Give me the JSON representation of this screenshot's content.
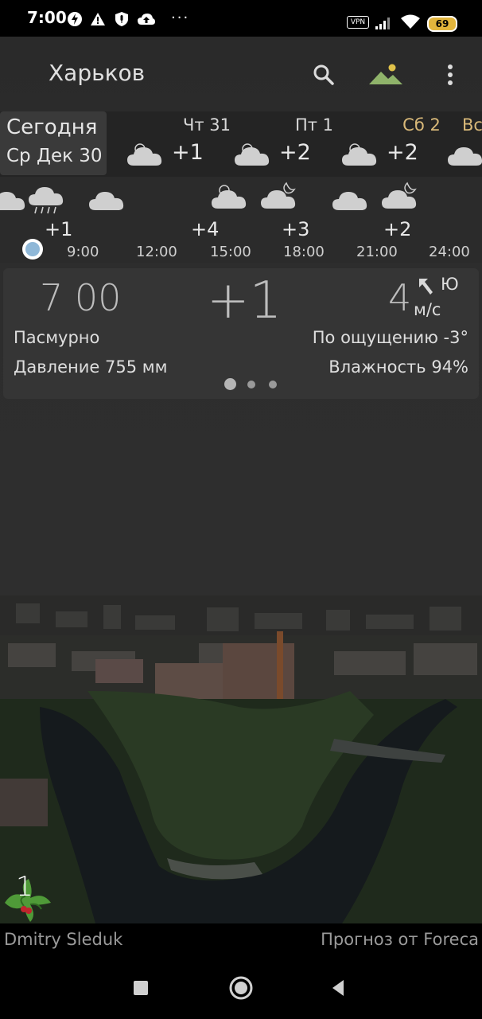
{
  "status_bar": {
    "time": "7:00",
    "dots": "···",
    "vpn": "VPN",
    "battery": "69",
    "icons": [
      "flash-icon",
      "warning-icon",
      "shield-mic-icon",
      "cloud-upload-icon",
      "signal-icon",
      "wifi-icon",
      "battery-icon"
    ]
  },
  "toolbar": {
    "city": "Харьков",
    "icons": [
      "search-icon",
      "landscape-icon",
      "more-vert-icon"
    ]
  },
  "days": {
    "today_line1": "Сегодня",
    "today_line2": "Ср Дек 30",
    "items": [
      {
        "name": "Чт 31",
        "temp": "+1",
        "icon": "partly-cloudy-icon",
        "color": "#d8d8d8"
      },
      {
        "name": "Пт 1",
        "temp": "+2",
        "icon": "partly-cloudy-icon",
        "color": "#d8d8d8"
      },
      {
        "name": "Сб 2",
        "temp": "+2",
        "icon": "partly-cloudy-icon",
        "color": "#d9b979"
      },
      {
        "name": "Вс",
        "temp": "",
        "icon": "cloud-icon",
        "color": "#d9b979"
      }
    ]
  },
  "hourly": {
    "temps": [
      "+1",
      "+4",
      "+3",
      "+2"
    ],
    "times": [
      "9:00",
      "12:00",
      "15:00",
      "18:00",
      "21:00",
      "24:00"
    ]
  },
  "current": {
    "time": "7 00",
    "temp": "+1",
    "wind_speed": "4",
    "wind_dir": "Ю",
    "wind_unit": "м/с",
    "condition": "Пасмурно",
    "feels_like": "По ощущению -3°",
    "pressure": "Давление 755 мм",
    "humidity": "Влажность 94%",
    "page_count": 3,
    "page_active": 1
  },
  "badge": {
    "number": "1",
    "icon": "holly-icon"
  },
  "footer": {
    "author": "Dmitry Sleduk",
    "forecast": "Прогноз от Foreca"
  },
  "navbar": {
    "icons": [
      "recents-square-icon",
      "home-circle-icon",
      "back-triangle-icon"
    ]
  },
  "colors": {
    "accent_weekend": "#d9b979",
    "landscape_icon": "#8fb36a",
    "sun": "#e0c24a"
  }
}
